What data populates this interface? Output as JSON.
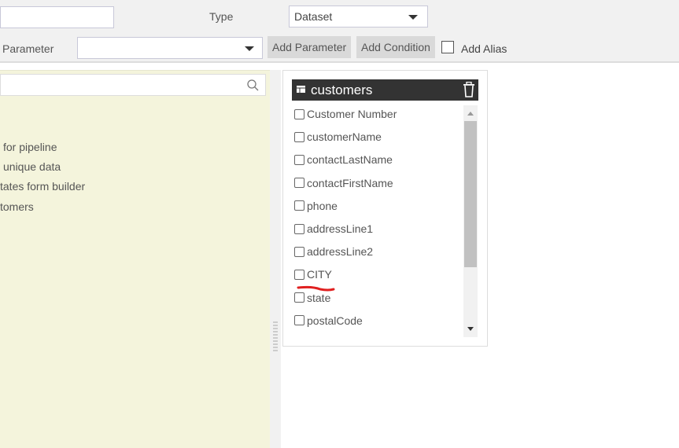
{
  "top": {
    "type_label": "Type",
    "type_value": "Dataset",
    "parameter_label": "Parameter",
    "parameter_value": "",
    "add_parameter": "Add Parameter",
    "add_condition": "Add Condition",
    "add_alias": "Add Alias",
    "name_value": ""
  },
  "left": {
    "search_placeholder": "",
    "items": [
      "for pipeline",
      "unique data",
      "tates form builder",
      "tomers"
    ]
  },
  "table": {
    "name": "customers",
    "fields": [
      "Customer Number",
      "customerName",
      "contactLastName",
      "contactFirstName",
      "phone",
      "addressLine1",
      "addressLine2",
      "CITY",
      "state",
      "postalCode"
    ],
    "annotation_color": "#e02020"
  }
}
